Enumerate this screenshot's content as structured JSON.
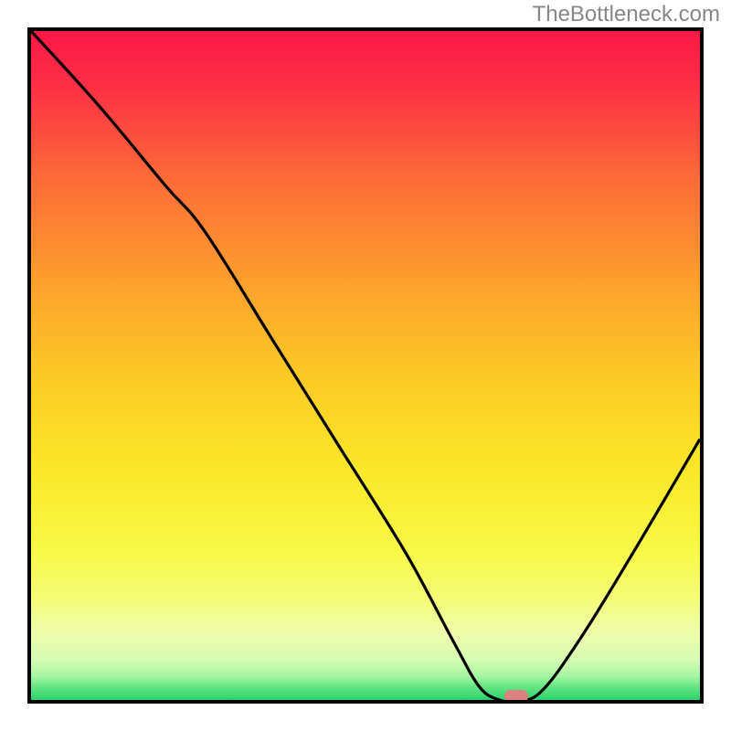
{
  "watermark": "TheBottleneck.com",
  "chart_data": {
    "type": "line",
    "title": "",
    "xlabel": "",
    "ylabel": "",
    "xlim": [
      0,
      100
    ],
    "ylim": [
      0,
      100
    ],
    "gradient": {
      "top_color": "#fc1847",
      "mid_colors": [
        "#fd8b2e",
        "#fbe829",
        "#f7fc5c",
        "#eefda0",
        "#b8f9a9"
      ],
      "bottom_color": "#2bd36e"
    },
    "series": [
      {
        "name": "bottleneck-curve",
        "x": [
          0,
          10,
          20,
          26,
          36,
          46,
          56,
          63,
          67,
          70,
          72,
          76,
          82,
          90,
          100
        ],
        "y": [
          100,
          89,
          77,
          70,
          54,
          38,
          22,
          9,
          2,
          0,
          0,
          1,
          9,
          22,
          39
        ]
      }
    ],
    "marker": {
      "x": 72.5,
      "y": 0.5,
      "label": "optimal-point"
    },
    "colors": {
      "curve": "#000000",
      "frame": "#000000",
      "marker": "#dd8080"
    }
  }
}
